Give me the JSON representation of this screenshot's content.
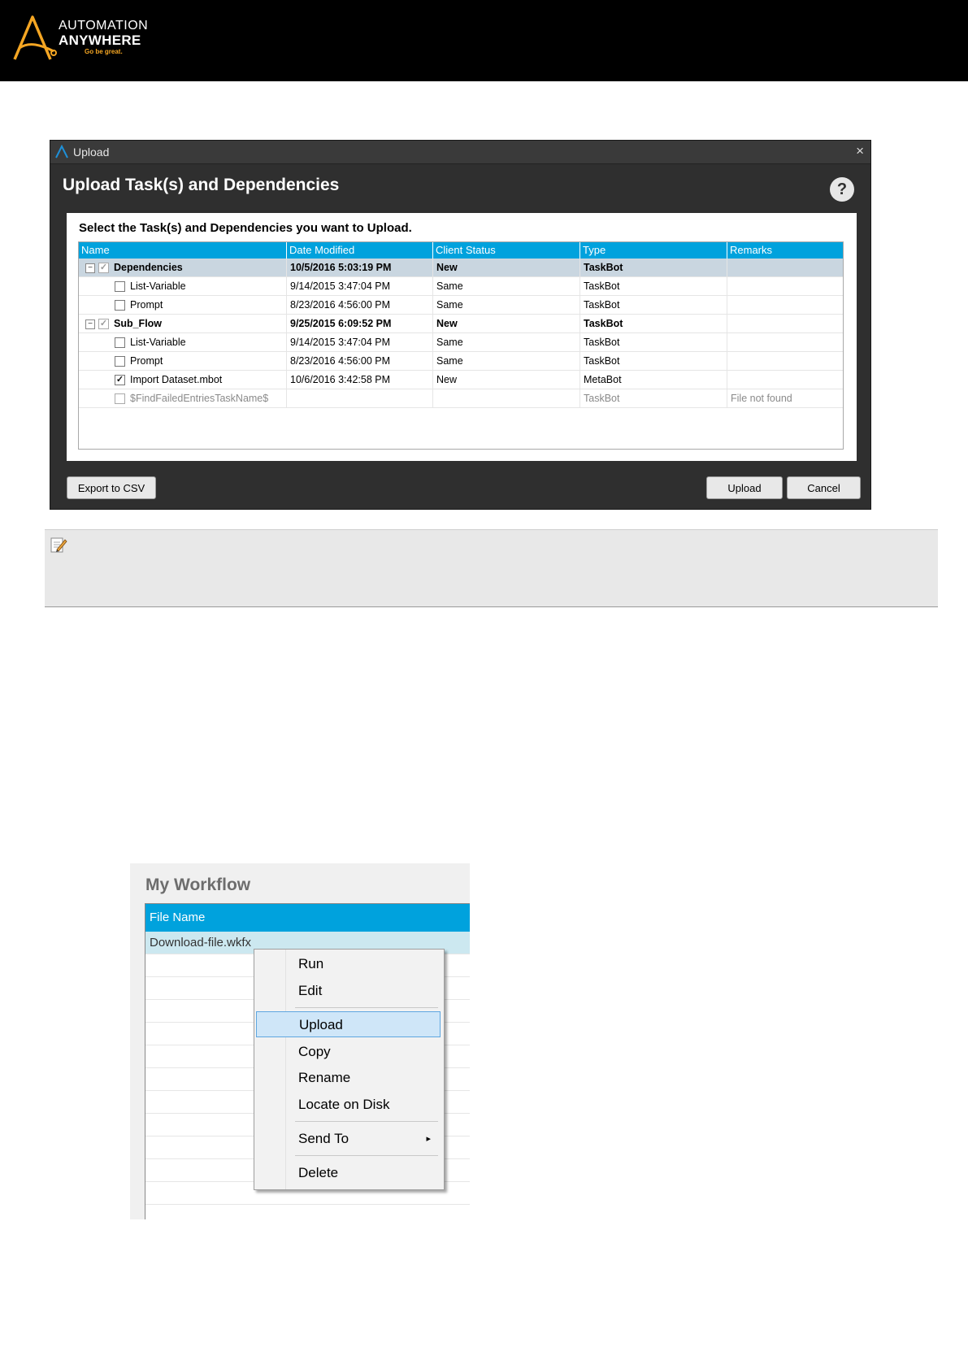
{
  "brand": {
    "line1": "AUTOMATION",
    "line2": "ANYWHERE",
    "tagline": "Go be great.",
    "accent_color": "#f5a623"
  },
  "dialog": {
    "window_title": "Upload",
    "close_glyph": "×",
    "heading": "Upload Task(s) and Dependencies",
    "help_glyph": "?",
    "instruction": "Select the Task(s) and Dependencies you want to Upload.",
    "columns": [
      "Name",
      "Date Modified",
      "Client Status",
      "Type",
      "Remarks"
    ],
    "rows": [
      {
        "name": "Dependencies",
        "date": "10/5/2016 5:03:19 PM",
        "status": "New",
        "type": "TaskBot",
        "remarks": ""
      },
      {
        "name": "List-Variable",
        "date": "9/14/2015 3:47:04 PM",
        "status": "Same",
        "type": "TaskBot",
        "remarks": ""
      },
      {
        "name": "Prompt",
        "date": "8/23/2016 4:56:00 PM",
        "status": "Same",
        "type": "TaskBot",
        "remarks": ""
      },
      {
        "name": "Sub_Flow",
        "date": "9/25/2015 6:09:52 PM",
        "status": "New",
        "type": "TaskBot",
        "remarks": ""
      },
      {
        "name": "List-Variable",
        "date": "9/14/2015 3:47:04 PM",
        "status": "Same",
        "type": "TaskBot",
        "remarks": ""
      },
      {
        "name": "Prompt",
        "date": "8/23/2016 4:56:00 PM",
        "status": "Same",
        "type": "TaskBot",
        "remarks": ""
      },
      {
        "name": "Import Dataset.mbot",
        "date": "10/6/2016 3:42:58 PM",
        "status": "New",
        "type": "MetaBot",
        "remarks": ""
      },
      {
        "name": "$FindFailedEntriesTaskName$",
        "date": "",
        "status": "",
        "type": "TaskBot",
        "remarks": "File not found"
      }
    ],
    "tree_collapse_glyph": "−",
    "check_glyph": "✓",
    "buttons": {
      "export": "Export to CSV",
      "upload": "Upload",
      "cancel": "Cancel"
    },
    "header_color": "#00a2dd"
  },
  "workflow": {
    "title": "My Workflow",
    "column": "File Name",
    "first_row": "Download-file.wkfx"
  },
  "context_menu": {
    "items": [
      "Run",
      "Edit",
      "Upload",
      "Copy",
      "Rename",
      "Locate on Disk",
      "Send To",
      "Delete"
    ],
    "highlighted": "Upload",
    "submenu_arrow": "▸"
  }
}
